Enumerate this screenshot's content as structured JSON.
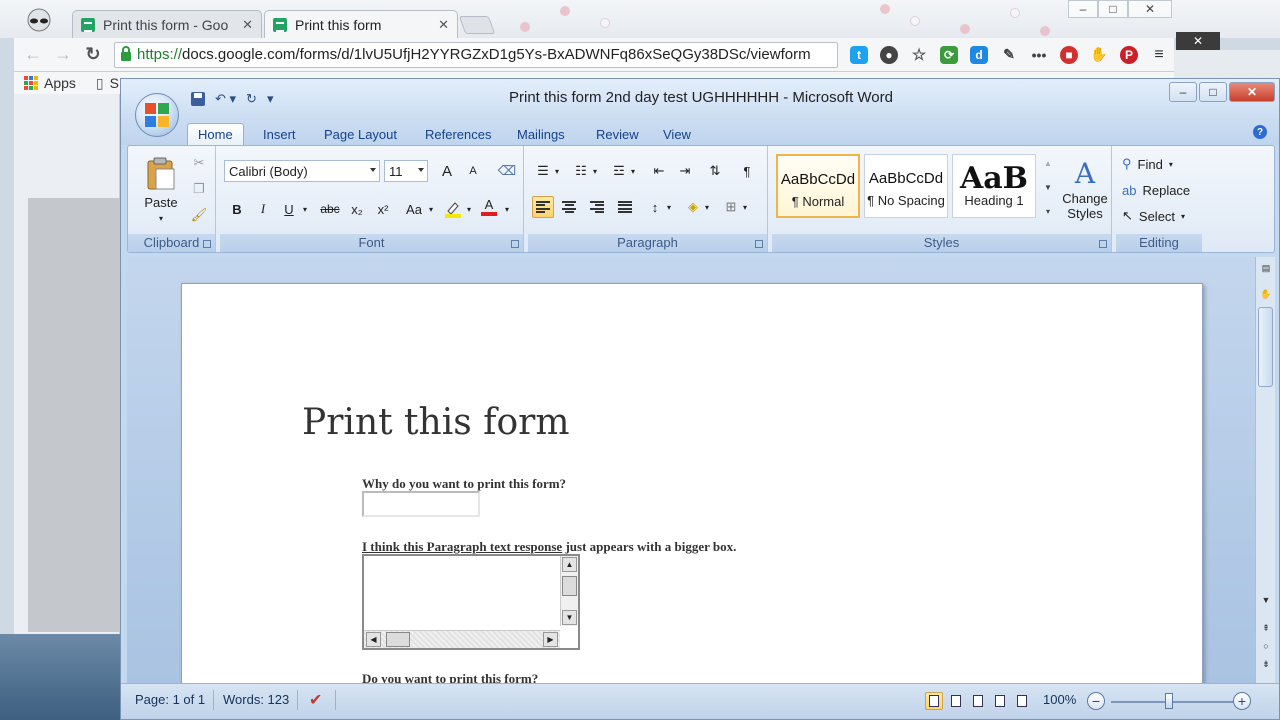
{
  "browser": {
    "tabs": [
      {
        "title": "Print this form - Goo",
        "close": "✕"
      },
      {
        "title": "Print this form",
        "close": "✕"
      }
    ],
    "window_controls": {
      "minimize": "–",
      "maximize": "□",
      "close": "✕"
    },
    "url": {
      "scheme": "https://",
      "rest": "docs.google.com/forms/d/1lvU5UfjH2YYRGZxD1g5Ys-BxADWNFq86xSeQGy38DSc/viewform"
    },
    "bookmarks": {
      "apps": "Apps",
      "partial": "S"
    },
    "overlay_close": "✕"
  },
  "word": {
    "title": "Print this form 2nd day test UGHHHHHH - Microsoft Word",
    "window_controls": {
      "minimize": "–",
      "maximize": "□",
      "close": "✕"
    },
    "tabs": [
      "Home",
      "Insert",
      "Page Layout",
      "References",
      "Mailings",
      "Review",
      "View"
    ],
    "help": "?",
    "ribbon": {
      "clipboard": {
        "label": "Clipboard",
        "paste": "Paste"
      },
      "font": {
        "label": "Font",
        "font_name": "Calibri (Body)",
        "font_size": "11",
        "grow": "A",
        "shrink": "A",
        "bold": "B",
        "italic": "I",
        "underline": "U",
        "strike": "abc",
        "subscript": "x₂",
        "superscript": "x²",
        "change_case": "Aa",
        "font_color": "A",
        "highlight_color": "#f5e800",
        "font_color_value": "#e21b1b"
      },
      "paragraph": {
        "label": "Paragraph",
        "show_hide": "¶"
      },
      "styles": {
        "label": "Styles",
        "items": [
          {
            "sample": "AaBbCcDd",
            "name": "¶ Normal"
          },
          {
            "sample": "AaBbCcDd",
            "name": "¶ No Spacing"
          },
          {
            "sample": "AaB",
            "name": "Heading 1"
          }
        ],
        "change_styles": "Change Styles"
      },
      "editing": {
        "label": "Editing",
        "find": "Find",
        "replace": "Replace",
        "select": "Select"
      }
    },
    "document": {
      "title": "Print this form",
      "q1": "Why do you want to print this form?",
      "q2_a": "I think this Paragraph text response",
      "q2_b": " just appears with a bigger box.",
      "q3": "Do you want to print this form?"
    },
    "status": {
      "page": "Page: 1 of 1",
      "words": "Words: 123",
      "zoom": "100%"
    }
  },
  "colors": {
    "word_blue": "#15428b",
    "sheets_green": "#21a464",
    "office_logo": [
      "#e8502c",
      "#f8b52b",
      "#2fa650",
      "#2f7de1"
    ]
  }
}
